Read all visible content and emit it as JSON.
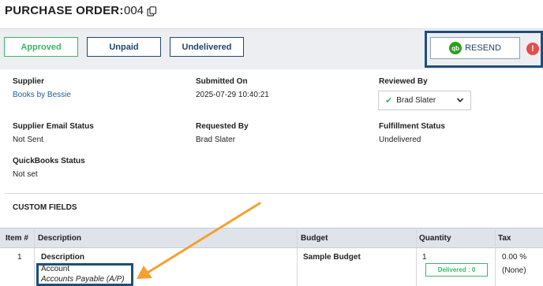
{
  "header": {
    "title": "PURCHASE ORDER:",
    "number": "004",
    "copy_icon": "copy-icon"
  },
  "status_bar": {
    "approved_label": "Approved",
    "unpaid_label": "Unpaid",
    "undelivered_label": "Undelivered",
    "resend_label": "RESEND",
    "resend_icon": "quickbooks-icon",
    "qb_glyph": "qb",
    "alert_glyph": "!",
    "alert_icon": "alert-icon"
  },
  "details": {
    "supplier": {
      "label": "Supplier",
      "value": "Books by Bessie"
    },
    "submitted_on": {
      "label": "Submitted On",
      "value": "2025-07-29 10:40:21"
    },
    "reviewed_by": {
      "label": "Reviewed By",
      "value": "Brad Slater"
    },
    "supplier_email_status": {
      "label": "Supplier Email Status",
      "value": "Not Sent"
    },
    "requested_by": {
      "label": "Requested By",
      "value": "Brad Slater"
    },
    "fulfillment_status": {
      "label": "Fulfillment Status",
      "value": "Undelivered"
    },
    "quickbooks_status": {
      "label": "QuickBooks Status",
      "value": "Not set"
    }
  },
  "custom_fields": {
    "title": "CUSTOM FIELDS"
  },
  "table": {
    "columns": [
      "Item #",
      "Description",
      "Budget",
      "Quantity",
      "Tax"
    ],
    "rows": [
      {
        "item": "1",
        "description_title": "Description",
        "account_label": "Account",
        "account_value": "Accounts Payable (A/P)",
        "budget": "Sample Budget",
        "quantity": "1",
        "delivered": "Delivered : 0",
        "tax_rate": "0.00 %",
        "tax_name": "(None)"
      }
    ]
  },
  "colors": {
    "approved_green": "#3bb56a",
    "brand_navy": "#23456a",
    "highlight_border": "#1e4f7a",
    "annotation_arrow": "#f5a030",
    "alert_red": "#e74c4c"
  }
}
